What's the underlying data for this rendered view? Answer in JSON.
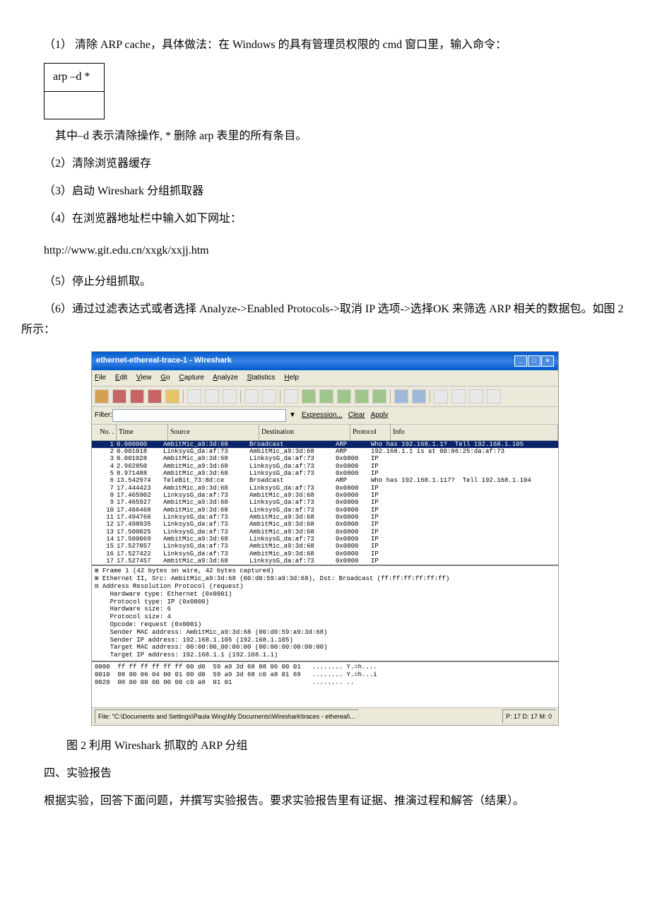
{
  "text": {
    "p1": "（1） 清除 ARP cache，具体做法：在 Windows 的具有管理员权限的 cmd 窗口里，输入命令：",
    "cmd": "arp –d *",
    "p2": "其中–d 表示清除操作, * 删除 arp 表里的所有条目。",
    "p3": "（2）清除浏览器缓存",
    "p4": "（3）启动 Wireshark 分组抓取器",
    "p5": "（4）在浏览器地址栏中输入如下网址：",
    "url": "http://www.git.edu.cn/xxgk/xxjj.htm",
    "p6": "（5）停止分组抓取。",
    "p7": "（6）通过过滤表达式或者选择 Analyze->Enabled Protocols->取消 IP 选项->选择OK 来筛选 ARP 相关的数据包。如图 2 所示：",
    "caption": "图 2 利用 Wireshark 抓取的 ARP 分组",
    "h4": "四、实验报告",
    "p8": "根据实验，回答下面问题，并撰写实验报告。要求实验报告里有证据、推演过程和解答（结果）。"
  },
  "wireshark": {
    "title": "ethernet-ethereal-trace-1 - Wireshark",
    "menus": [
      "File",
      "Edit",
      "View",
      "Go",
      "Capture",
      "Analyze",
      "Statistics",
      "Help"
    ],
    "filter_label": "Filter:",
    "filter_links": [
      "Expression...",
      "Clear",
      "Apply"
    ],
    "columns": [
      "No. .",
      "Time",
      "Source",
      "Destination",
      "Protocol",
      "Info"
    ],
    "rows": [
      {
        "no": "1",
        "time": "0.000000",
        "src": "AmbitMic_a9:3d:68",
        "dst": "Broadcast",
        "proto": "ARP",
        "info": "Who has 192.168.1.1?  Tell 192.168.1.105",
        "sel": true
      },
      {
        "no": "2",
        "time": "0.001018",
        "src": "LinksysG_da:af:73",
        "dst": "AmbitMic_a9:3d:68",
        "proto": "ARP",
        "info": "192.168.1.1 is at 00:06:25:da:af:73"
      },
      {
        "no": "3",
        "time": "0.001028",
        "src": "AmbitMic_a9:3d:68",
        "dst": "LinksysG_da:af:73",
        "proto": "0x0800",
        "info": "IP"
      },
      {
        "no": "4",
        "time": "2.962850",
        "src": "AmbitMic_a9:3d:68",
        "dst": "LinksysG_da:af:73",
        "proto": "0x0800",
        "info": "IP"
      },
      {
        "no": "5",
        "time": "8.971488",
        "src": "AmbitMic_a9:3d:68",
        "dst": "LinksysG_da:af:73",
        "proto": "0x0800",
        "info": "IP"
      },
      {
        "no": "6",
        "time": "13.542974",
        "src": "TeleBit_73:8d:ce",
        "dst": "Broadcast",
        "proto": "ARP",
        "info": "Who has 192.168.1.117?  Tell 192.168.1.104"
      },
      {
        "no": "7",
        "time": "17.444423",
        "src": "AmbitMic_a9:3d:68",
        "dst": "LinksysG_da:af:73",
        "proto": "0x0800",
        "info": "IP"
      },
      {
        "no": "8",
        "time": "17.465902",
        "src": "LinksysG_da:af:73",
        "dst": "AmbitMic_a9:3d:68",
        "proto": "0x0800",
        "info": "IP"
      },
      {
        "no": "9",
        "time": "17.465927",
        "src": "AmbitMic_a9:3d:68",
        "dst": "LinksysG_da:af:73",
        "proto": "0x0800",
        "info": "IP"
      },
      {
        "no": "10",
        "time": "17.466468",
        "src": "AmbitMic_a9:3d:68",
        "dst": "LinksysG_da:af:73",
        "proto": "0x0800",
        "info": "IP"
      },
      {
        "no": "11",
        "time": "17.494766",
        "src": "LinksysG_da:af:73",
        "dst": "AmbitMic_a9:3d:68",
        "proto": "0x0800",
        "info": "IP"
      },
      {
        "no": "12",
        "time": "17.498935",
        "src": "LinksysG_da:af:73",
        "dst": "AmbitMic_a9:3d:68",
        "proto": "0x0800",
        "info": "IP"
      },
      {
        "no": "13",
        "time": "17.500025",
        "src": "LinksysG_da:af:73",
        "dst": "AmbitMic_a9:3d:68",
        "proto": "0x0800",
        "info": "IP"
      },
      {
        "no": "14",
        "time": "17.500069",
        "src": "AmbitMic_a9:3d:68",
        "dst": "LinksysG_da:af:73",
        "proto": "0x0800",
        "info": "IP"
      },
      {
        "no": "15",
        "time": "17.527057",
        "src": "LinksysG_da:af:73",
        "dst": "AmbitMic_a9:3d:68",
        "proto": "0x0800",
        "info": "IP"
      },
      {
        "no": "16",
        "time": "17.527422",
        "src": "LinksysG_da:af:73",
        "dst": "AmbitMic_a9:3d:68",
        "proto": "0x0800",
        "info": "IP"
      },
      {
        "no": "17",
        "time": "17.527457",
        "src": "AmbitMic_a9:3d:68",
        "dst": "LinksysG_da:af:73",
        "proto": "0x0800",
        "info": "IP"
      }
    ],
    "details": [
      "⊞ Frame 1 (42 bytes on wire, 42 bytes captured)",
      "⊞ Ethernet II, Src: AmbitMic_a9:3d:68 (00:d0:59:a9:3d:68), Dst: Broadcast (ff:ff:ff:ff:ff:ff)",
      "⊟ Address Resolution Protocol (request)",
      "    Hardware type: Ethernet (0x0001)",
      "    Protocol type: IP (0x0800)",
      "    Hardware size: 6",
      "    Protocol size: 4",
      "    Opcode: request (0x0001)",
      "    Sender MAC address: AmbitMic_a9:3d:68 (00:d0:59:a9:3d:68)",
      "    Sender IP address: 192.168.1.105 (192.168.1.105)",
      "    Target MAC address: 00:00:00_00:00:00 (00:00:00:00:00:00)",
      "    Target IP address: 192.168.1.1 (192.168.1.1)"
    ],
    "bytes": [
      "0000  ff ff ff ff ff ff 00 d0  59 a9 3d 68 08 06 00 01   ........ Y.=h....",
      "0010  08 00 06 04 00 01 00 d0  59 a9 3d 68 c0 a8 01 69   ........ Y.=h...i",
      "0020  00 00 00 00 00 00 c0 a8  01 01                     ........ .."
    ],
    "status_left": "File: \"C:\\Documents and Settings\\Paula Wing\\My Documents\\Wireshark\\traces - ethereal\\...",
    "status_right": "P: 17 D: 17 M: 0"
  }
}
